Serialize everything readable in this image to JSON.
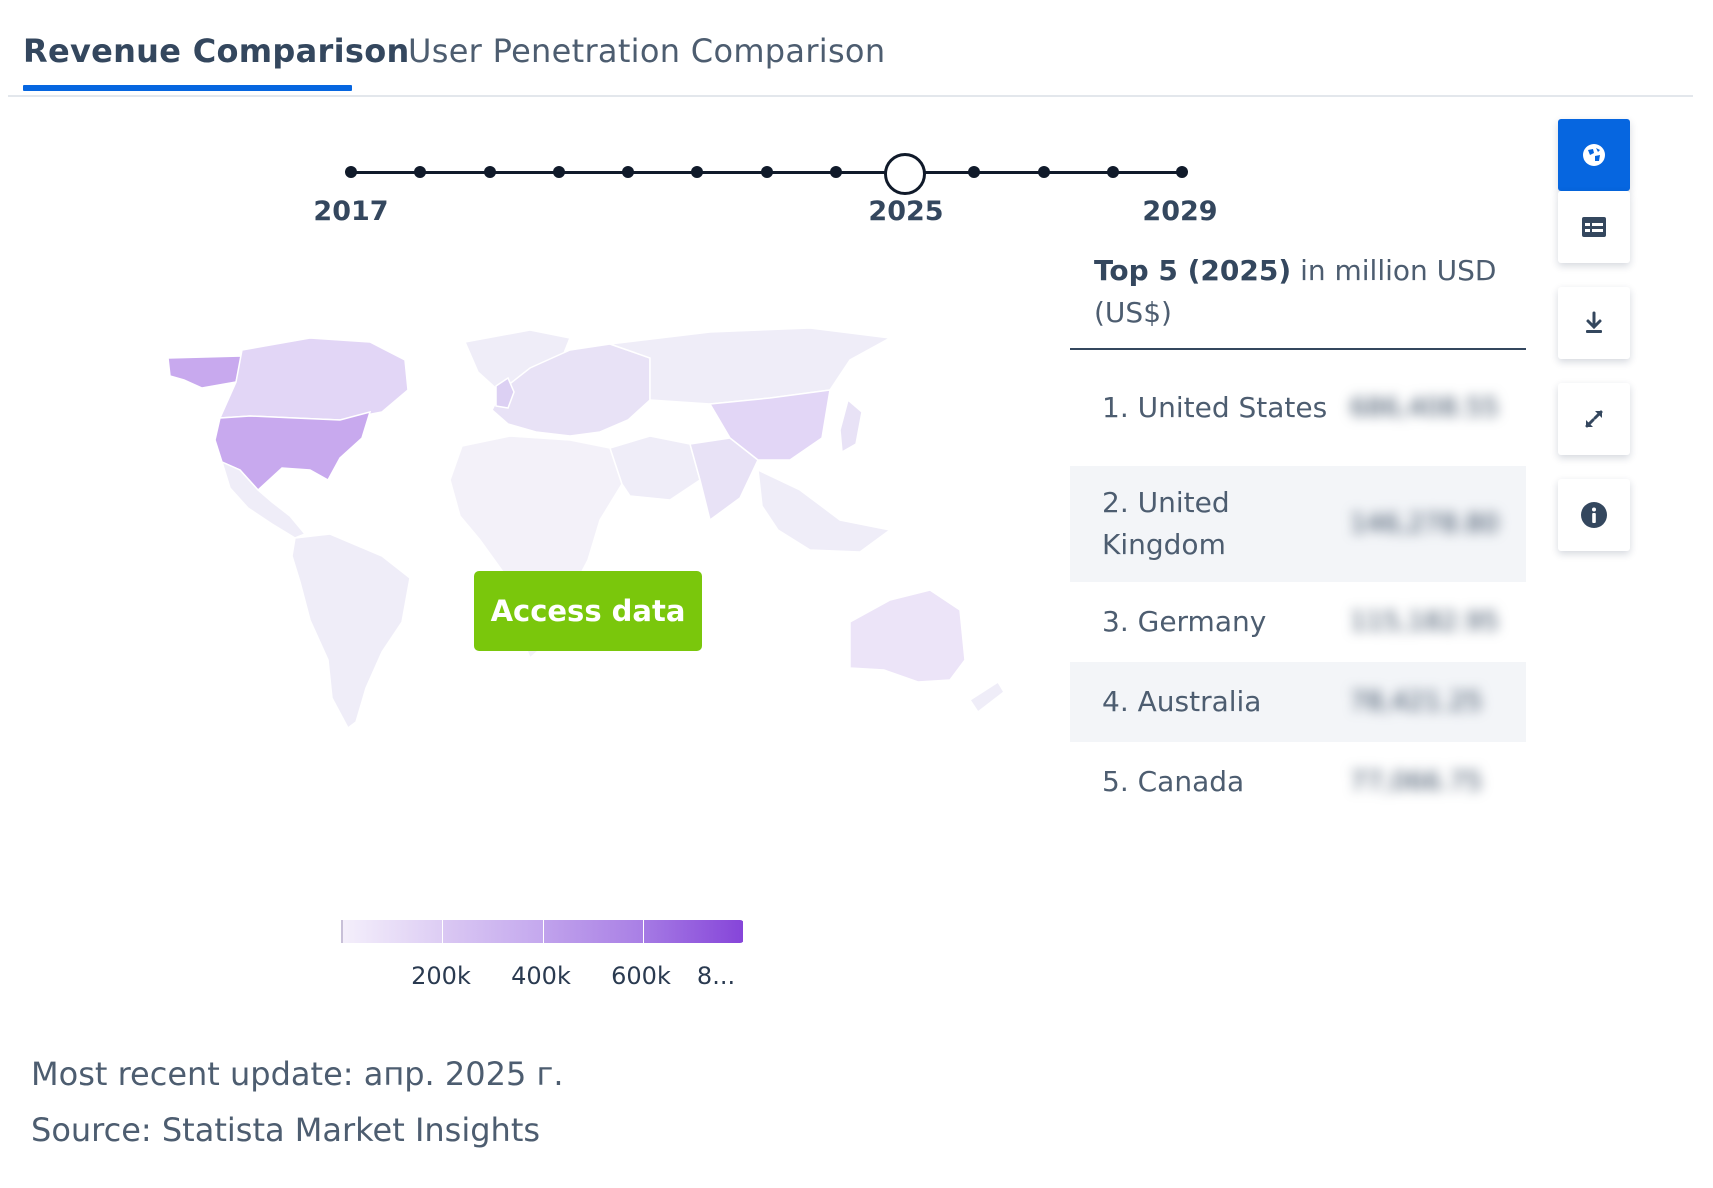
{
  "tabs": [
    {
      "label": "Revenue Comparison",
      "active": true
    },
    {
      "label": "User Penetration Comparison",
      "active": false
    }
  ],
  "timeline": {
    "years": [
      2017,
      2018,
      2019,
      2020,
      2021,
      2022,
      2023,
      2024,
      2025,
      2026,
      2027,
      2028,
      2029
    ],
    "selected": 2025,
    "labels": [
      "2017",
      "2025",
      "2029"
    ]
  },
  "map": {
    "access_button": "Access data",
    "highlight_color": "#c8a9ee",
    "base_color": "#efedf8"
  },
  "legend": {
    "ticks": [
      "200k",
      "400k",
      "600k",
      "8..."
    ],
    "colors": [
      "#ece4f8",
      "#d2bcf1",
      "#b794ea",
      "#9a6be2"
    ]
  },
  "top5": {
    "title_bold": "Top 5 (2025)",
    "title_rest": " in million USD (US$)",
    "rows": [
      {
        "name": "1. United States",
        "value": "686,408.55"
      },
      {
        "name": "2. United Kingdom",
        "value": "146,278.80"
      },
      {
        "name": "3. Germany",
        "value": "115,182.95"
      },
      {
        "name": "4. Australia",
        "value": "78,421.25"
      },
      {
        "name": "5. Canada",
        "value": "77,066.75"
      }
    ]
  },
  "toolbar": {
    "icons": [
      "globe-icon",
      "table-icon",
      "download-icon",
      "expand-icon",
      "info-icon"
    ],
    "active_color": "#0666e0"
  },
  "footer": {
    "update": "Most recent update: апр. 2025 г.",
    "source": "Source: Statista Market Insights"
  }
}
